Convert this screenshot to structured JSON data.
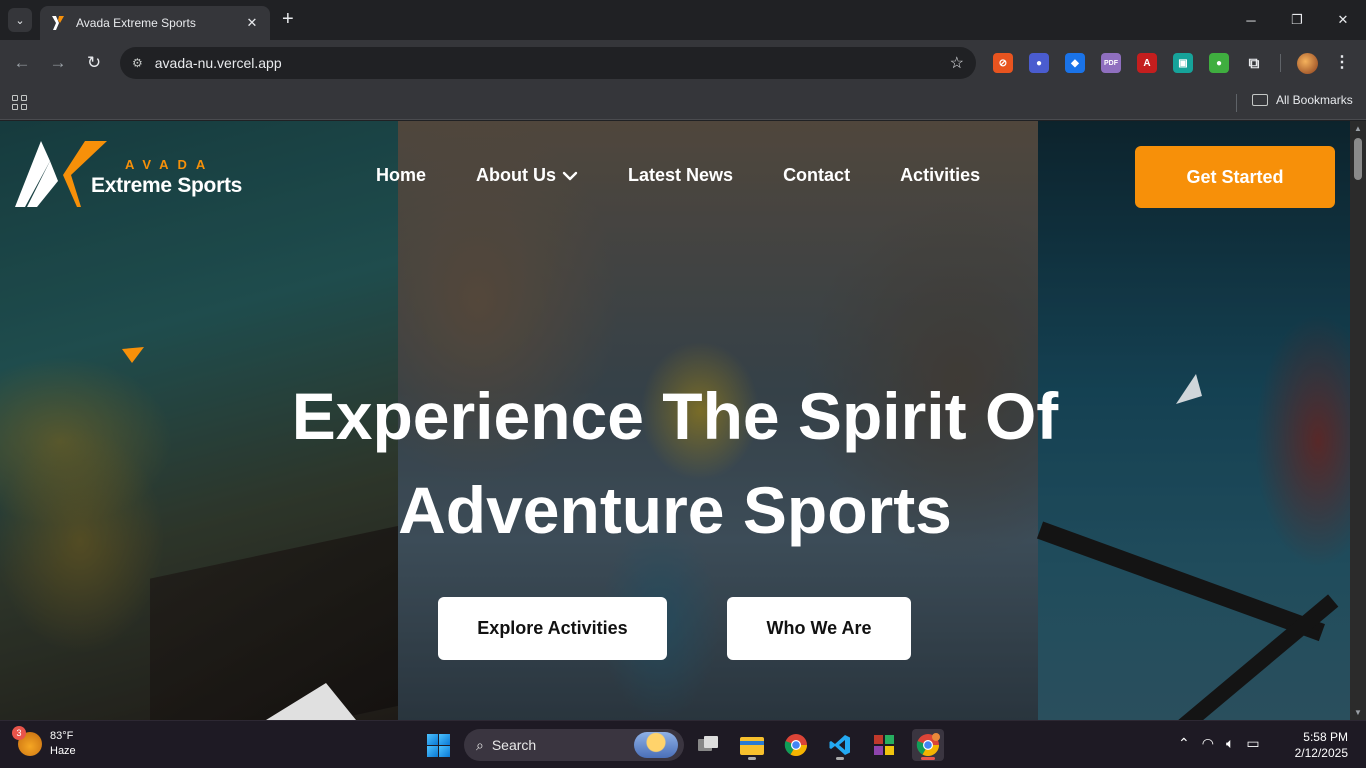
{
  "browser": {
    "tab_title": "Avada Extreme Sports",
    "url": "avada-nu.vercel.app",
    "all_bookmarks": "All Bookmarks",
    "extensions": [
      {
        "name": "block-extension",
        "color": "#e8541f",
        "glyph": "⊘"
      },
      {
        "name": "meet-extension",
        "color": "#4a5ccf",
        "glyph": "●"
      },
      {
        "name": "shield-extension",
        "color": "#1a73e8",
        "glyph": "◆"
      },
      {
        "name": "pdf-extension",
        "color": "#8f6fbf",
        "glyph": "PDF"
      },
      {
        "name": "acrobat-extension",
        "color": "#c41e1e",
        "glyph": "A"
      },
      {
        "name": "screenshot-extension",
        "color": "#16a39a",
        "glyph": "▣"
      },
      {
        "name": "idea-extension",
        "color": "#3fae3f",
        "glyph": "●"
      }
    ]
  },
  "site": {
    "logo_top": "AVADA",
    "logo_name": "Extreme Sports",
    "nav": [
      "Home",
      "About Us",
      "Latest News",
      "Contact",
      "Activities"
    ],
    "cta": "Get Started",
    "hero_line1": "Experience The Spirit Of",
    "hero_line2": "Adventure Sports",
    "btn_explore": "Explore Activities",
    "btn_who": "Who We Are",
    "accent": "#f79009"
  },
  "taskbar": {
    "weather_temp": "83°F",
    "weather_desc": "Haze",
    "weather_badge": "3",
    "search_placeholder": "Search",
    "time": "5:58 PM",
    "date": "2/12/2025"
  }
}
